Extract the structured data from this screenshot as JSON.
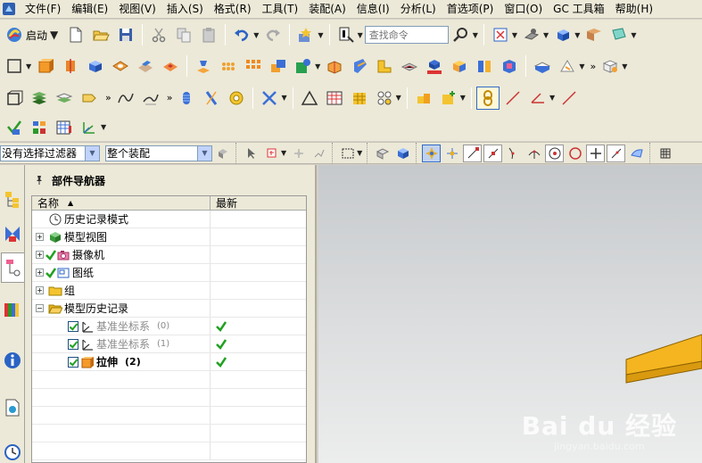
{
  "menu": [
    "文件(F)",
    "编辑(E)",
    "视图(V)",
    "插入(S)",
    "格式(R)",
    "工具(T)",
    "装配(A)",
    "信息(I)",
    "分析(L)",
    "首选项(P)",
    "窗口(O)",
    "GC 工具箱",
    "帮助(H)"
  ],
  "toolbar": {
    "start_label": "启动",
    "search_placeholder": "查找命令"
  },
  "selection_bar": {
    "filter_value": "没有选择过滤器",
    "scope_value": "整个装配"
  },
  "navigator": {
    "title": "部件导航器",
    "col_name": "名称",
    "col_latest": "最新",
    "rows": [
      {
        "label": "历史记录模式",
        "sub": "",
        "icon": "clock-icon"
      },
      {
        "label": "模型视图",
        "sub": "",
        "icon": "model-views-icon"
      },
      {
        "label": "摄像机",
        "sub": "",
        "icon": "camera-icon"
      },
      {
        "label": "图纸",
        "sub": "",
        "icon": "drawing-icon"
      },
      {
        "label": "组",
        "sub": "",
        "icon": "folder-icon"
      },
      {
        "label": "模型历史记录",
        "sub": "",
        "icon": "folder-open-icon"
      },
      {
        "label": "基准坐标系",
        "sub": "(0)",
        "icon": "datum-csys-icon"
      },
      {
        "label": "基准坐标系",
        "sub": "(1)",
        "icon": "datum-csys-icon"
      },
      {
        "label": "拉伸",
        "sub": "(2)",
        "icon": "extrude-icon"
      }
    ]
  },
  "watermark": {
    "brand": "Bai du 经验",
    "url": "jingyan.baidu.com"
  },
  "colors": {
    "chrome": "#ece9d8",
    "solid_face": "#f5b520",
    "check_green": "#21a121"
  }
}
